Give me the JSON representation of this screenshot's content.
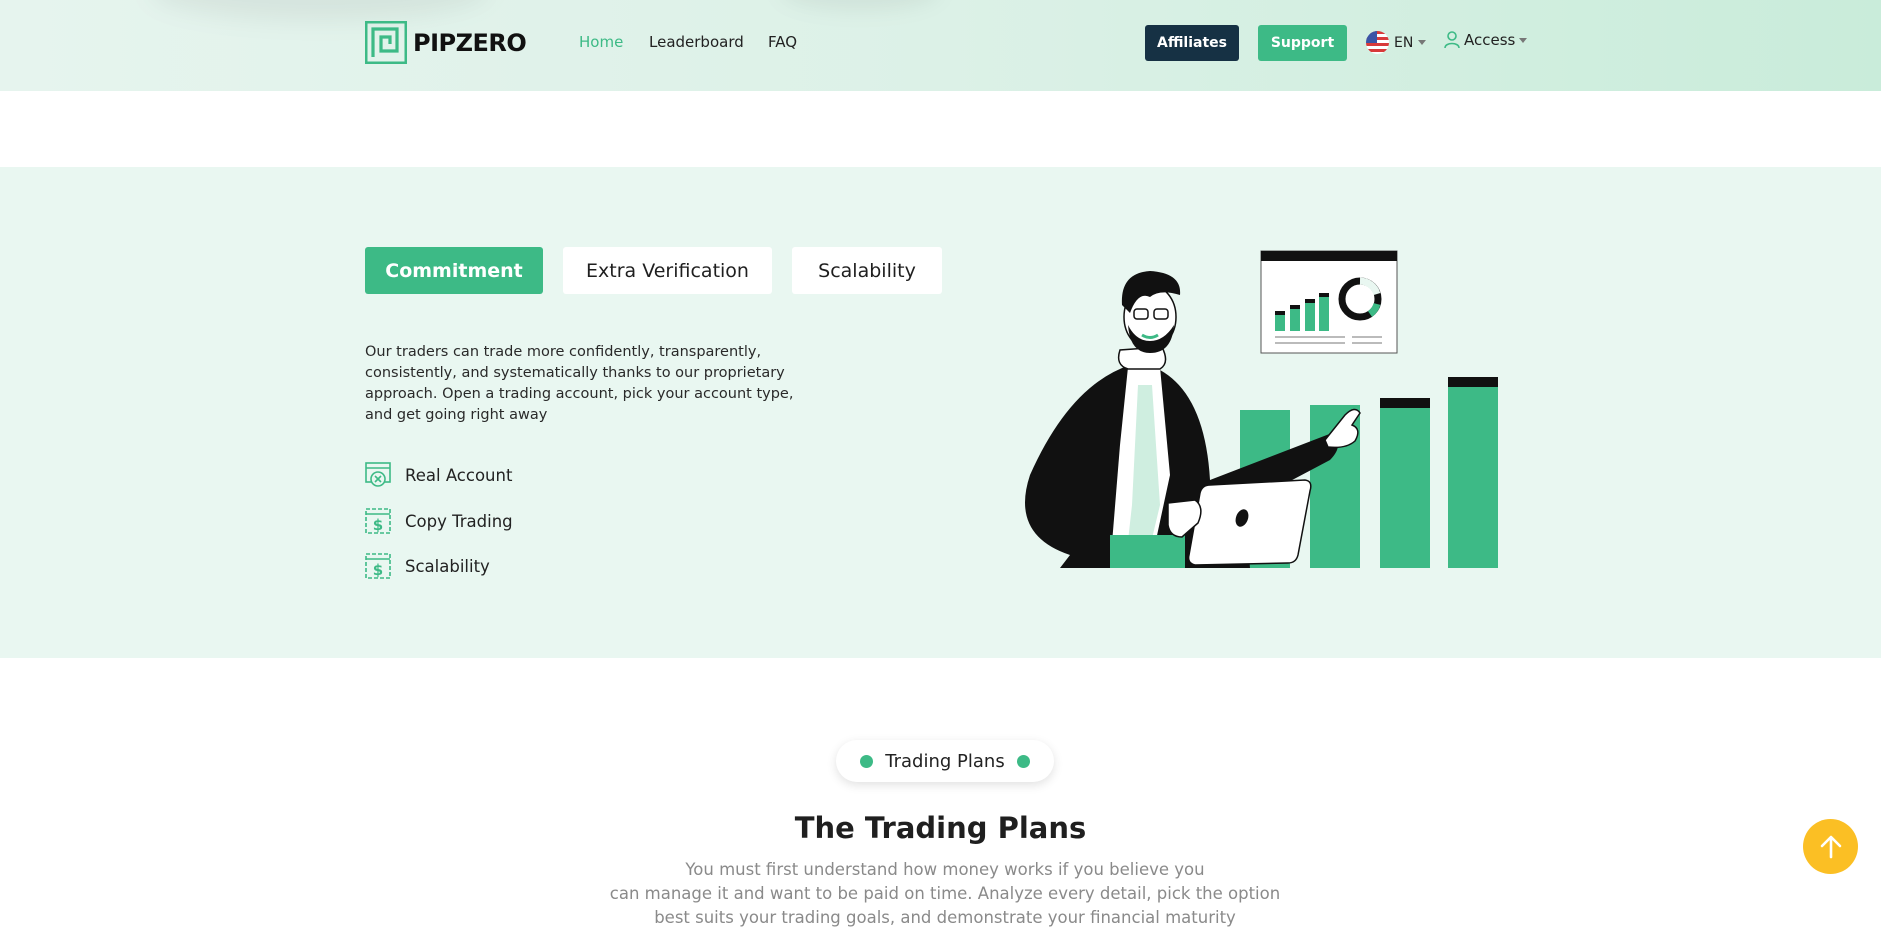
{
  "brand": {
    "name": "PIPZERO",
    "accent": "#3dba86",
    "dark": "#163144"
  },
  "nav": {
    "home": "Home",
    "leaderboard": "Leaderboard",
    "faq": "FAQ"
  },
  "header_actions": {
    "affiliates": "Affiliates",
    "support": "Support",
    "language": "EN",
    "access": "Access"
  },
  "feature": {
    "tabs": [
      "Commitment",
      "Extra Verification",
      "Scalability"
    ],
    "active_tab": "Commitment",
    "description": "Our traders can trade more confidently, transparently, consistently, and systematically thanks to our proprietary approach. Open a trading account, pick your account type, and get going right away",
    "items": [
      {
        "label": "Real Account",
        "icon": "account-x-icon"
      },
      {
        "label": "Copy Trading",
        "icon": "dollar-doc-icon"
      },
      {
        "label": "Scalability",
        "icon": "dollar-doc-icon"
      }
    ]
  },
  "plans": {
    "pill": "Trading Plans",
    "title": "The Trading Plans",
    "subtitle_lines": [
      "You must first understand how money works if you believe you",
      "can manage it and want to be paid on time. Analyze every detail, pick the option",
      "best suits your trading goals, and demonstrate your financial maturity"
    ]
  },
  "icons": {
    "scroll_top": "arrow-up-icon"
  }
}
